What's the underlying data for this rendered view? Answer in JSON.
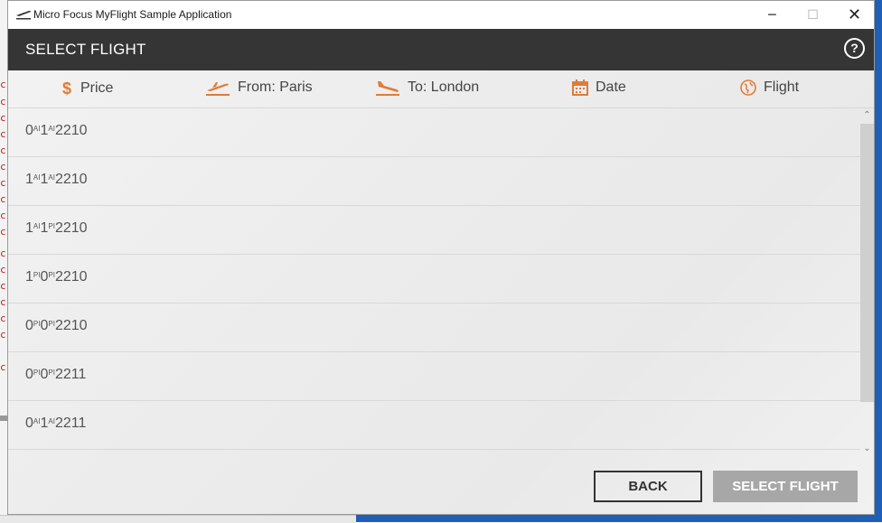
{
  "window": {
    "title": "Micro Focus MyFlight Sample Application",
    "icon": "airplane-takeoff-icon",
    "controls": {
      "minimize": "─",
      "maximize": "☐",
      "close": "✕"
    }
  },
  "header": {
    "title": "SELECT FLIGHT",
    "help_label": "?"
  },
  "columns": {
    "price": {
      "label": "Price",
      "icon": "dollar-icon"
    },
    "from": {
      "label": "From: Paris",
      "icon": "takeoff-icon"
    },
    "to": {
      "label": "To: London",
      "icon": "landing-icon"
    },
    "date": {
      "label": "Date",
      "icon": "calendar-icon"
    },
    "flight": {
      "label": "Flight",
      "icon": "globe-icon"
    }
  },
  "rows": [
    {
      "a": "0",
      "b": "AI",
      "c": "1",
      "d": "AI",
      "e": "2210"
    },
    {
      "a": "1",
      "b": "AI",
      "c": "1",
      "d": "AI",
      "e": "2210"
    },
    {
      "a": "1",
      "b": "AI",
      "c": "1",
      "d": "PI",
      "e": "2210"
    },
    {
      "a": "1",
      "b": "PI",
      "c": "0",
      "d": "PI",
      "e": "2210"
    },
    {
      "a": "0",
      "b": "PI",
      "c": "0",
      "d": "PI",
      "e": "2210"
    },
    {
      "a": "0",
      "b": "PI",
      "c": "0",
      "d": "PI",
      "e": "2211"
    },
    {
      "a": "0",
      "b": "AI",
      "c": "1",
      "d": "AI",
      "e": "2211"
    }
  ],
  "buttons": {
    "back": "BACK",
    "select": "SELECT FLIGHT"
  },
  "colors": {
    "accent": "#e07b39",
    "header_bg": "#353535",
    "select_disabled": "#a7a7a7"
  }
}
